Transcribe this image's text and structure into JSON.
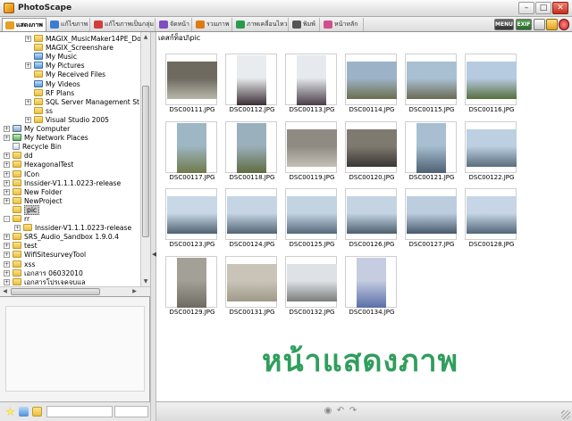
{
  "window": {
    "title": "PhotoScape"
  },
  "tabs": [
    {
      "label": "แสดงภาพ",
      "active": true,
      "icon": "viewer-icon",
      "color": "#e6a023"
    },
    {
      "label": "แก้ไขภาพ",
      "active": false,
      "icon": "editor-icon",
      "color": "#3d7bd1"
    },
    {
      "label": "แก้ไขภาพเป็นกลุ่ม",
      "active": false,
      "icon": "batch-icon",
      "color": "#d13d3d"
    },
    {
      "label": "จัดหน้า",
      "active": false,
      "icon": "page-icon",
      "color": "#7f4dbf"
    },
    {
      "label": "รวมภาพ",
      "active": false,
      "icon": "combine-icon",
      "color": "#e07a10"
    },
    {
      "label": "ภาพเคลื่อนไหว",
      "active": false,
      "icon": "gif-icon",
      "color": "#2a9b4c"
    },
    {
      "label": "พิมพ์",
      "active": false,
      "icon": "print-icon",
      "color": "#555555"
    },
    {
      "label": "หน้าหลัก",
      "active": false,
      "icon": "home-icon",
      "color": "#d14f8f"
    }
  ],
  "toolbar": {
    "menu_label": "MENU",
    "exif_label": "EXIF"
  },
  "tree": [
    {
      "label": "MAGIX_MusicMaker14PE_Do",
      "indent": 3,
      "expander": "+",
      "icon": "folder"
    },
    {
      "label": "MAGIX_Screenshare",
      "indent": 3,
      "expander": "",
      "icon": "folder"
    },
    {
      "label": "My Music",
      "indent": 3,
      "expander": "",
      "icon": "media"
    },
    {
      "label": "My Pictures",
      "indent": 3,
      "expander": "+",
      "icon": "media"
    },
    {
      "label": "My Received Files",
      "indent": 3,
      "expander": "",
      "icon": "folder"
    },
    {
      "label": "My Videos",
      "indent": 3,
      "expander": "",
      "icon": "media"
    },
    {
      "label": "RF Plans",
      "indent": 3,
      "expander": "",
      "icon": "folder"
    },
    {
      "label": "SQL Server Management St",
      "indent": 3,
      "expander": "+",
      "icon": "folder"
    },
    {
      "label": "ss",
      "indent": 3,
      "expander": "",
      "icon": "folder"
    },
    {
      "label": "Visual Studio 2005",
      "indent": 3,
      "expander": "+",
      "icon": "folder"
    },
    {
      "label": "My Computer",
      "indent": 1,
      "expander": "+",
      "icon": "computer"
    },
    {
      "label": "My Network Places",
      "indent": 1,
      "expander": "+",
      "icon": "network"
    },
    {
      "label": "Recycle Bin",
      "indent": 1,
      "expander": "",
      "icon": "bin"
    },
    {
      "label": "dd",
      "indent": 1,
      "expander": "+",
      "icon": "folder"
    },
    {
      "label": "HexagonalTest",
      "indent": 1,
      "expander": "+",
      "icon": "folder"
    },
    {
      "label": "ICon",
      "indent": 1,
      "expander": "+",
      "icon": "folder"
    },
    {
      "label": "Inssider-V1.1.1.0223-release",
      "indent": 1,
      "expander": "+",
      "icon": "folder"
    },
    {
      "label": "New Folder",
      "indent": 1,
      "expander": "+",
      "icon": "folder"
    },
    {
      "label": "NewProject",
      "indent": 1,
      "expander": "+",
      "icon": "folder"
    },
    {
      "label": "pic",
      "indent": 1,
      "expander": "",
      "icon": "folder",
      "selected": true
    },
    {
      "label": "rr",
      "indent": 1,
      "expander": "-",
      "icon": "folder"
    },
    {
      "label": "Inssider-V1.1.1.0223-release",
      "indent": 2,
      "expander": "+",
      "icon": "folder"
    },
    {
      "label": "SRS_Audio_Sandbox 1.9.0.4",
      "indent": 1,
      "expander": "+",
      "icon": "folder"
    },
    {
      "label": "test",
      "indent": 1,
      "expander": "+",
      "icon": "folder"
    },
    {
      "label": "WifiSitesurveyTool",
      "indent": 1,
      "expander": "+",
      "icon": "folder"
    },
    {
      "label": "xss",
      "indent": 1,
      "expander": "+",
      "icon": "folder"
    },
    {
      "label": "เอกสาร 06032010",
      "indent": 1,
      "expander": "+",
      "icon": "folder"
    },
    {
      "label": "เอกสารโปรเจคจบแล",
      "indent": 1,
      "expander": "+",
      "icon": "folder"
    }
  ],
  "main": {
    "path": "เดสก์ท็อป\\pic",
    "watermark": "หน้าแสดงภาพ"
  },
  "thumbnails": [
    {
      "name": "DSC00111.JPG",
      "orient": "landscape",
      "c1": "#6f6a60",
      "c2": "#b8b6a9"
    },
    {
      "name": "DSC00112.JPG",
      "orient": "portrait",
      "c1": "#e9ecee",
      "c2": "#3b2f36"
    },
    {
      "name": "DSC00113.JPG",
      "orient": "portrait",
      "c1": "#e6eaee",
      "c2": "#4a3d49"
    },
    {
      "name": "DSC00114.JPG",
      "orient": "landscape",
      "c1": "#9cb3c7",
      "c2": "#6b6e4e"
    },
    {
      "name": "DSC00115.JPG",
      "orient": "landscape",
      "c1": "#a9c0d3",
      "c2": "#6b6a55"
    },
    {
      "name": "DSC00116.JPG",
      "orient": "landscape",
      "c1": "#b6cbe0",
      "c2": "#586e3e"
    },
    {
      "name": "DSC00117.JPG",
      "orient": "portrait",
      "c1": "#9eb7c4",
      "c2": "#6f7a4a"
    },
    {
      "name": "DSC00118.JPG",
      "orient": "portrait",
      "c1": "#9bb0bd",
      "c2": "#5f6c42"
    },
    {
      "name": "DSC00119.JPG",
      "orient": "landscape",
      "c1": "#8f8b83",
      "c2": "#c4c0b6"
    },
    {
      "name": "DSC00120.JPG",
      "orient": "landscape",
      "c1": "#7e7a70",
      "c2": "#3a3632"
    },
    {
      "name": "DSC00121.JPG",
      "orient": "portrait",
      "c1": "#a8bfd2",
      "c2": "#4d5f73"
    },
    {
      "name": "DSC00122.JPG",
      "orient": "landscape",
      "c1": "#bcd0e2",
      "c2": "#596d7c"
    },
    {
      "name": "DSC00123.JPG",
      "orient": "landscape",
      "c1": "#c8d8e6",
      "c2": "#4f6273"
    },
    {
      "name": "DSC00124.JPG",
      "orient": "landscape",
      "c1": "#c5d5e3",
      "c2": "#536677"
    },
    {
      "name": "DSC00125.JPG",
      "orient": "landscape",
      "c1": "#c2d3e2",
      "c2": "#566a7b"
    },
    {
      "name": "DSC00126.JPG",
      "orient": "landscape",
      "c1": "#c4d4e2",
      "c2": "#4d6070"
    },
    {
      "name": "DSC00127.JPG",
      "orient": "landscape",
      "c1": "#bccde0",
      "c2": "#485b6c"
    },
    {
      "name": "DSC00128.JPG",
      "orient": "landscape",
      "c1": "#c6d6e6",
      "c2": "#52677a"
    },
    {
      "name": "DSC00129.JPG",
      "orient": "portrait",
      "c1": "#a3a197",
      "c2": "#6e6c62"
    },
    {
      "name": "DSC00131.JPG",
      "orient": "landscape",
      "c1": "#c9c4b7",
      "c2": "#a09a8a"
    },
    {
      "name": "DSC00132.JPG",
      "orient": "landscape",
      "c1": "#dde2e6",
      "c2": "#7a7d7c"
    },
    {
      "name": "DSC00134.JPG",
      "orient": "portrait",
      "c1": "#c6cde0",
      "c2": "#5a6fa8"
    }
  ]
}
